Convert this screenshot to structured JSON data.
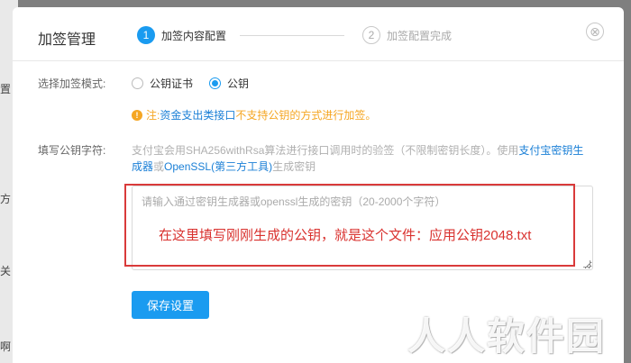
{
  "background": {
    "fragments": [
      "置",
      "方",
      "关",
      "啊"
    ]
  },
  "modal": {
    "title": "加签管理",
    "steps": [
      {
        "number": "1",
        "label": "加签内容配置"
      },
      {
        "number": "2",
        "label": "加签配置完成"
      }
    ],
    "close_icon": "⊗"
  },
  "form": {
    "mode_label": "选择加签模式:",
    "mode_options": [
      {
        "label": "公钥证书",
        "selected": false
      },
      {
        "label": "公钥",
        "selected": true
      }
    ],
    "note": {
      "icon": "!",
      "prefix": "注:",
      "link": "资金支出类接口",
      "suffix": "不支持公钥的方式进行加签。"
    },
    "key_label": "填写公钥字符:",
    "description": {
      "text1": "支付宝会用SHA256withRsa算法进行接口调用时的验签（不限制密钥长度）。使用",
      "link1": "支付宝密钥生成器",
      "text2": "或",
      "link2": "OpenSSL(第三方工具)",
      "text3": "生成密钥"
    },
    "textarea_placeholder": "请输入通过密钥生成器或openssl生成的密钥（20-2000个字符）",
    "save_label": "保存设置"
  },
  "annotation": {
    "text": "在这里填写刚刚生成的公钥，就是这个文件：应用公钥2048.txt",
    "color": "#d9322f"
  },
  "watermark": "人人软件园",
  "colors": {
    "accent": "#1a9bf0",
    "warning": "#f5a623",
    "link": "#1a7fd6"
  }
}
